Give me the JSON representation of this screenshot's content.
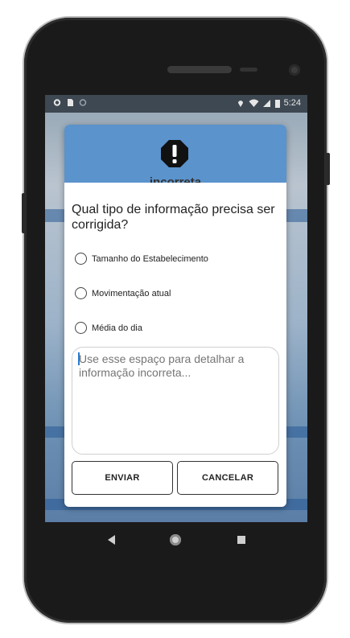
{
  "status_bar": {
    "time": "5:24",
    "left_icons": [
      "settings-icon",
      "sd-card-icon",
      "sync-icon"
    ],
    "right_icons": [
      "location-icon",
      "wifi-icon",
      "signal-icon",
      "battery-icon"
    ]
  },
  "dialog": {
    "header_icon": "warning-octagon-icon",
    "partial_title": "incorreta",
    "question": "Qual tipo de informação precisa ser corrigida?",
    "options": [
      {
        "label": "Tamanho do Estabelecimento",
        "selected": false
      },
      {
        "label": "Movimentação atual",
        "selected": false
      },
      {
        "label": "Média do dia",
        "selected": false
      }
    ],
    "details": {
      "value": "",
      "placeholder": "Use esse espaço para detalhar a informação incorreta..."
    },
    "submit_label": "ENVIAR",
    "cancel_label": "CANCELAR"
  },
  "nav_bar": {
    "icons": [
      "back-icon",
      "home-icon",
      "recent-apps-icon"
    ]
  },
  "colors": {
    "header": "#5b93cc",
    "status_bar": "#3e4852",
    "phone": "#1a1a1a"
  }
}
